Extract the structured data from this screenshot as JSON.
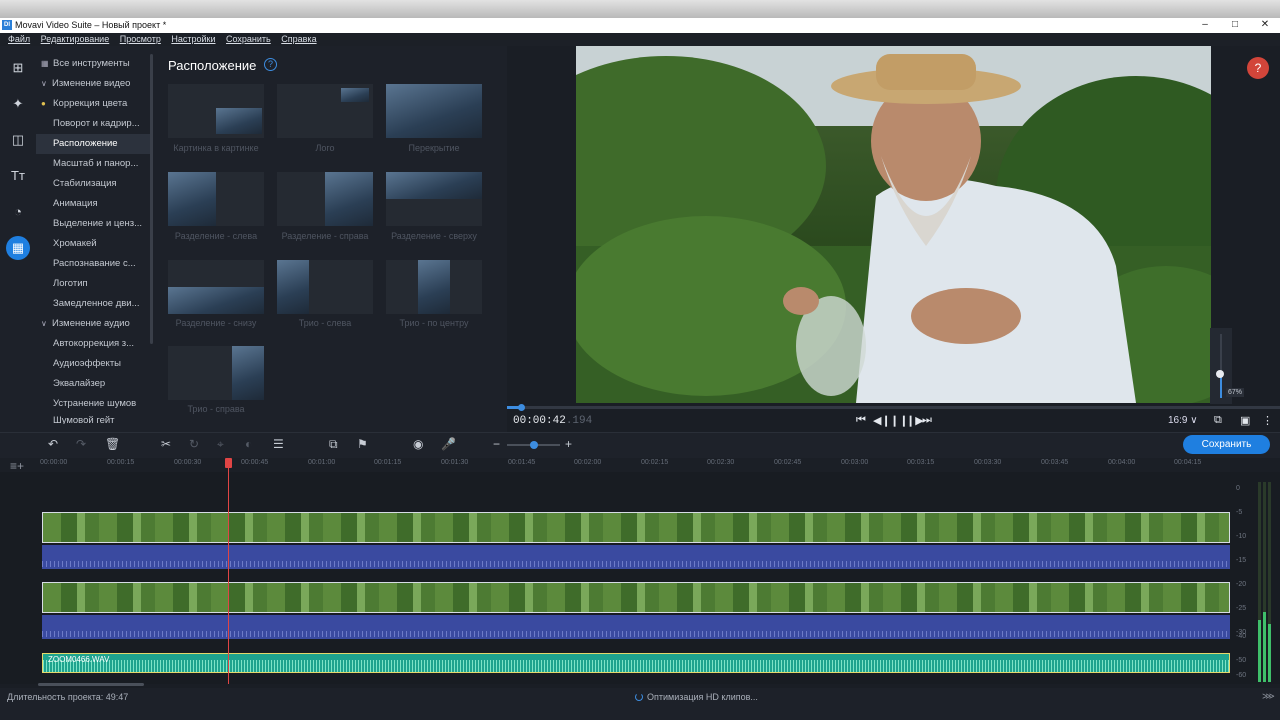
{
  "window": {
    "title": "Movavi Video Suite – Новый проект *",
    "app_icon": "DI"
  },
  "menu": [
    "Файл",
    "Редактирование",
    "Просмотр",
    "Настройки",
    "Сохранить",
    "Справка"
  ],
  "sidebar": {
    "items": [
      {
        "label": "Все инструменты",
        "kind": "grid"
      },
      {
        "label": "Изменение видео",
        "kind": "group"
      },
      {
        "label": "Коррекция цвета",
        "kind": "dot"
      },
      {
        "label": "Поворот и кадрир...",
        "kind": "item"
      },
      {
        "label": "Расположение",
        "kind": "selected"
      },
      {
        "label": "Масштаб и панор...",
        "kind": "item"
      },
      {
        "label": "Стабилизация",
        "kind": "item"
      },
      {
        "label": "Анимация",
        "kind": "item"
      },
      {
        "label": "Выделение и ценз...",
        "kind": "item"
      },
      {
        "label": "Хромакей",
        "kind": "item"
      },
      {
        "label": "Распознавание с...",
        "kind": "item"
      },
      {
        "label": "Логотип",
        "kind": "item"
      },
      {
        "label": "Замедленное дви...",
        "kind": "item"
      },
      {
        "label": "Изменение аудио",
        "kind": "group"
      },
      {
        "label": "Автокоррекция з...",
        "kind": "item"
      },
      {
        "label": "Аудиоэффекты",
        "kind": "item"
      },
      {
        "label": "Эквалайзер",
        "kind": "item"
      },
      {
        "label": "Устранение шумов",
        "kind": "item"
      },
      {
        "label": "Шумовой гейт",
        "kind": "item"
      }
    ]
  },
  "panel": {
    "title": "Расположение",
    "tiles": [
      "Картинка в картинке",
      "Лого",
      "Перекрытие",
      "Разделение - слева",
      "Разделение - справа",
      "Разделение - сверху",
      "Разделение - снизу",
      "Трио - слева",
      "Трио - по центру",
      "Трио - справа"
    ]
  },
  "player": {
    "timecode": "00:00:42",
    "timecode_ms": ".194",
    "aspect": "16:9",
    "volume_tooltip": "67%",
    "help": "?"
  },
  "toolbar": {
    "save_label": "Сохранить"
  },
  "ruler": [
    "00:00:00",
    "00:00:15",
    "00:00:30",
    "00:00:45",
    "00:01:00",
    "00:01:15",
    "00:01:30",
    "00:01:45",
    "00:02:00",
    "00:02:15",
    "00:02:30",
    "00:02:45",
    "00:03:00",
    "00:03:15",
    "00:03:30",
    "00:03:45",
    "00:04:00",
    "00:04:15"
  ],
  "music_clip": "ZOOM0466.WAV",
  "meter_labels": [
    "0",
    "-5",
    "-10",
    "-15",
    "-20",
    "-25",
    "-30",
    "-40",
    "-50",
    "-60"
  ],
  "status": {
    "duration": "Длительность проекта: 49:47",
    "progress": "Оптимизация HD клипов..."
  }
}
